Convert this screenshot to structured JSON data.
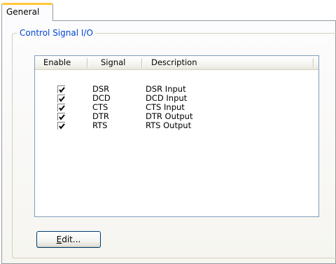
{
  "tabs": [
    {
      "label": "General",
      "selected": true
    }
  ],
  "group": {
    "title": "Control Signal I/O"
  },
  "list": {
    "columns": [
      "Enable",
      "Signal",
      "Description"
    ],
    "rows": [
      {
        "enabled": true,
        "signal": "DSR",
        "description": "DSR Input"
      },
      {
        "enabled": true,
        "signal": "DCD",
        "description": "DCD Input"
      },
      {
        "enabled": true,
        "signal": "CTS",
        "description": "CTS Input"
      },
      {
        "enabled": true,
        "signal": "DTR",
        "description": "DTR Output"
      },
      {
        "enabled": true,
        "signal": "RTS",
        "description": "RTS Output"
      }
    ]
  },
  "buttons": {
    "edit_mnemonic": "E",
    "edit_rest": "dit..."
  },
  "colors": {
    "tab_accent": "#ffc83c",
    "group_title": "#0046d5",
    "list_border": "#7f9db9",
    "button_border": "#003c74"
  }
}
